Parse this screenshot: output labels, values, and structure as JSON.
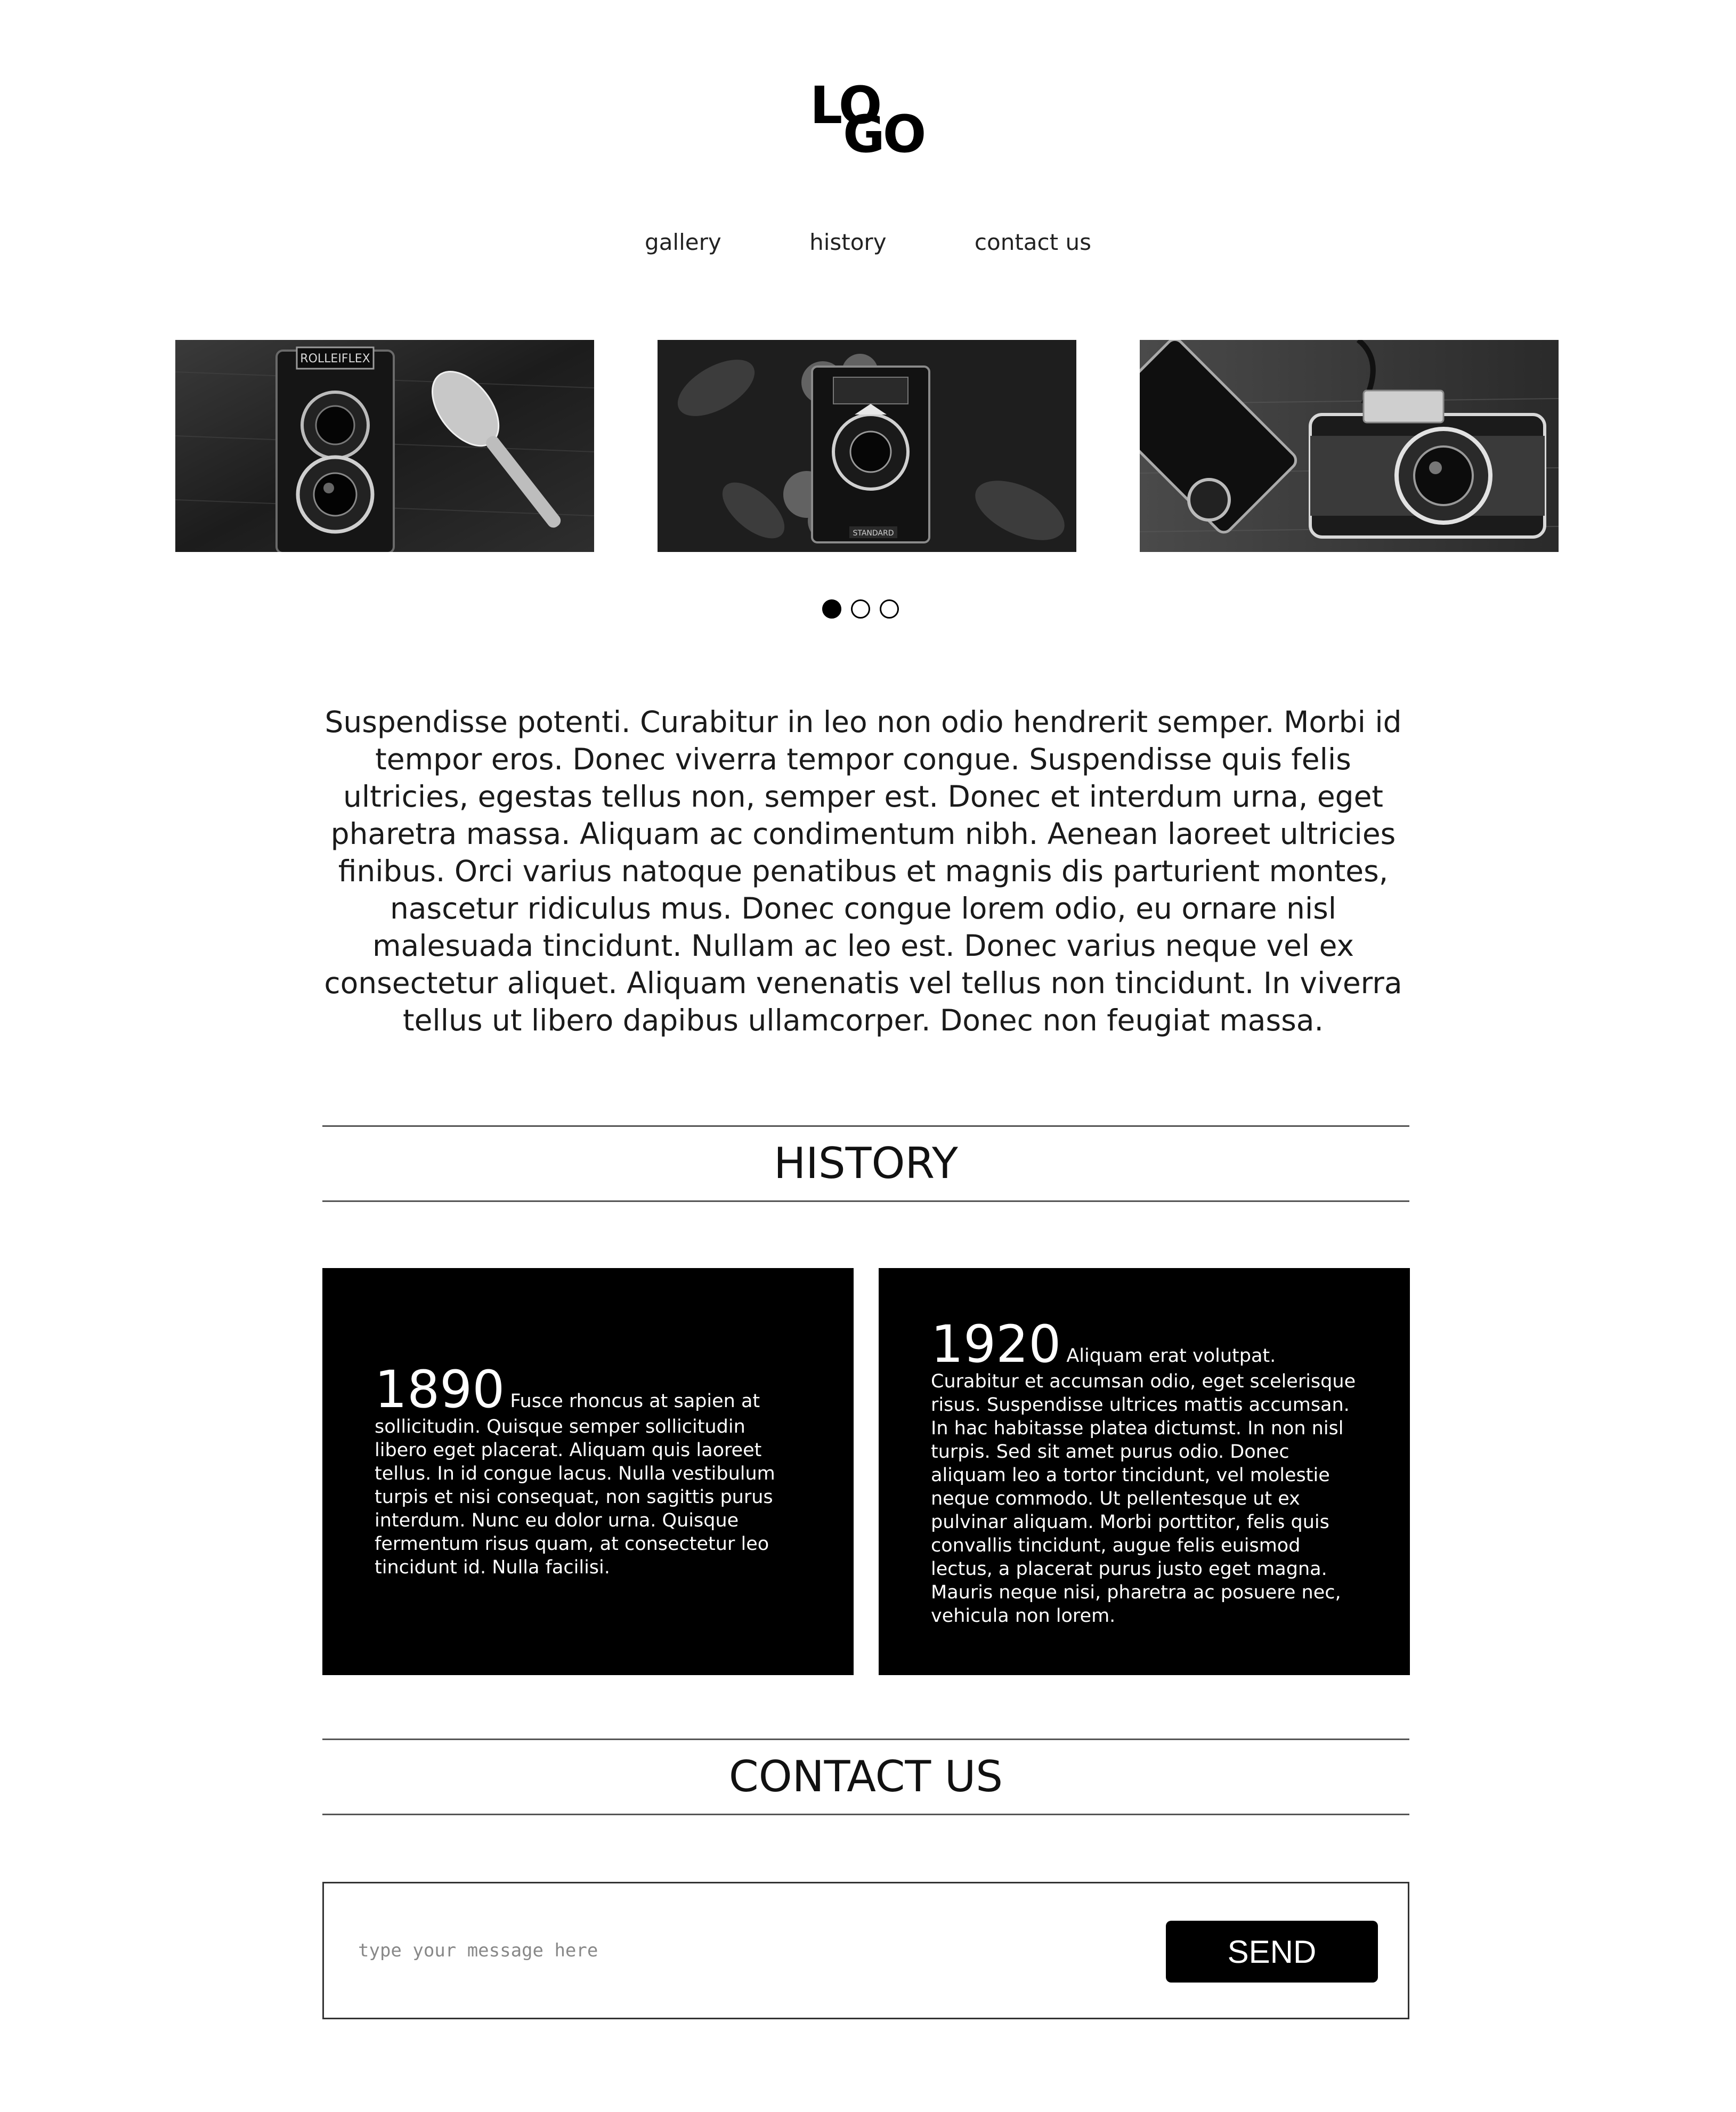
{
  "logo": {
    "line1": "LO",
    "line2": "GO"
  },
  "nav": {
    "items": [
      {
        "label": "gallery"
      },
      {
        "label": "history"
      },
      {
        "label": "contact us"
      }
    ]
  },
  "gallery": {
    "images": [
      {
        "subject": "twin-lens reflex camera with spoon-fork",
        "camera_label": "ROLLEIFLEX"
      },
      {
        "subject": "vintage folding camera with leaves",
        "camera_label": "STANDARD"
      },
      {
        "subject": "compact rangefinder cameras"
      }
    ],
    "active_slide": 1,
    "slide_count": 3
  },
  "intro": {
    "text": "Suspendisse potenti. Curabitur in leo non odio hendrerit semper. Morbi id tempor eros. Donec viverra tempor congue. Suspendisse quis felis ultricies, egestas tellus non, semper est. Donec et interdum urna, eget pharetra massa. Aliquam ac condimentum nibh. Aenean laoreet ultricies finibus. Orci varius natoque penatibus et magnis dis parturient montes, nascetur ridiculus mus. Donec congue lorem odio, eu ornare nisl malesuada tincidunt. Nullam ac leo est. Donec varius neque vel ex consectetur aliquet. Aliquam venenatis vel tellus non tincidunt. In viverra tellus ut libero dapibus ullamcorper. Donec non feugiat massa."
  },
  "history": {
    "heading": "HISTORY",
    "cards": [
      {
        "year": "1890",
        "text": "Fusce rhoncus at sapien at sollicitudin. Quisque semper sollicitudin libero eget placerat. Aliquam quis laoreet tellus. In id congue lacus. Nulla vestibulum turpis et nisi consequat, non sagittis purus interdum. Nunc eu dolor urna. Quisque fermentum risus quam, at consectetur leo tincidunt id. Nulla facilisi."
      },
      {
        "year": "1920",
        "text": "Aliquam erat volutpat. Curabitur et accumsan odio, eget scelerisque risus. Suspendisse ultrices mattis accumsan. In hac habitasse platea dictumst. In non nisl turpis. Sed sit amet purus odio. Donec aliquam leo a tortor tincidunt, vel molestie neque commodo. Ut pellentesque ut ex pulvinar aliquam. Morbi porttitor, felis quis convallis tincidunt, augue felis euismod lectus, a placerat purus justo eget magna. Mauris neque nisi, pharetra ac posuere nec, vehicula non lorem."
      }
    ]
  },
  "contact": {
    "heading": "CONTACT US",
    "message_placeholder": "type your message here",
    "message_value": "",
    "send_label": "SEND"
  },
  "colors": {
    "background": "#ffffff",
    "text": "#111111",
    "card_background": "#000000",
    "card_text": "#ffffff",
    "button_background": "#000000",
    "button_text": "#ffffff"
  }
}
